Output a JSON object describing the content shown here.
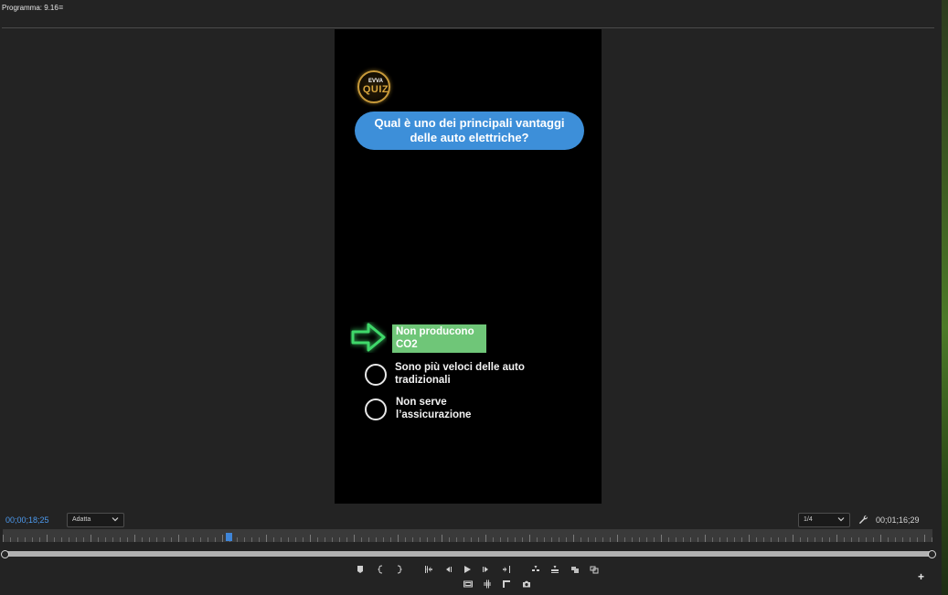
{
  "panel": {
    "title": "Programma: 9.16",
    "menu_icon": "hamburger-menu-icon",
    "menu_glyph": "≡"
  },
  "video": {
    "logo_small": "EVVA",
    "logo_big": "QUIZ",
    "question": "Qual è uno dei principali vantaggi delle auto elettriche?",
    "answers": [
      {
        "text": "Non producono CO2",
        "selected": true
      },
      {
        "text": "Sono più veloci delle auto tradizionali",
        "selected": false
      },
      {
        "text": "Non serve l’assicurazione",
        "selected": false
      }
    ],
    "colors": {
      "question_bg": "#3d8fd9",
      "correct_bg": "#6fc678",
      "arrow": "#3fd86a"
    }
  },
  "timecode": {
    "current": "00;00;18;25",
    "duration": "00;01;16;29"
  },
  "fit_select": {
    "value": "Adatta"
  },
  "quality_select": {
    "value": "1/4"
  },
  "playhead": {
    "fraction": 0.24
  },
  "controls": {
    "row1": [
      "add-marker-icon",
      "mark-in-icon",
      "mark-out-icon",
      "go-to-in-icon",
      "step-back-icon",
      "play-icon",
      "step-forward-icon",
      "go-to-out-icon",
      "insert-icon",
      "overwrite-icon",
      "lift-icon",
      "extract-icon"
    ],
    "row2": [
      "safe-margins-icon",
      "comparison-view-icon",
      "proxy-toggle-icon",
      "export-frame-icon"
    ],
    "add_button": "+"
  },
  "accent_color": "#4d9bf0"
}
